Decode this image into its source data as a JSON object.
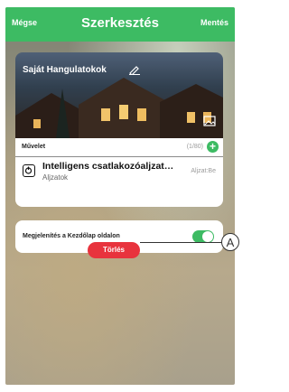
{
  "header": {
    "cancel_label": "Mégse",
    "title": "Szerkesztés",
    "save_label": "Mentés"
  },
  "scene": {
    "name": "Saját Hangulatokok"
  },
  "actions": {
    "label": "Művelet",
    "count": "(1/80)",
    "add_icon": "plus"
  },
  "device": {
    "name": "Intelligens csatlakozóaljzat…",
    "category": "Aljzatok",
    "state": "Aljzat:Be"
  },
  "homepage_toggle": {
    "label": "Megjelenítés a Kezdőlap oldalon",
    "enabled": true
  },
  "delete_label": "Törlés",
  "callout": "A",
  "colors": {
    "accent": "#3dbb63",
    "danger": "#e8333d"
  }
}
